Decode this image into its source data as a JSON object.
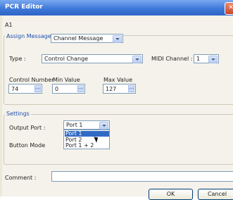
{
  "window": {
    "title": "PCR Editor",
    "close_glyph": "✕"
  },
  "section": {
    "name": "A1"
  },
  "assign": {
    "legend": "Assign Message :",
    "message_value": "Channel Message",
    "type_label": "Type :",
    "type_value": "Control Change",
    "midi_label": "MIDI Channel :",
    "midi_value": "1",
    "control_number_label": "Control Number",
    "control_number_value": "74",
    "min_label": "Min Value",
    "min_value": "0",
    "max_label": "Max Value",
    "max_value": "127"
  },
  "settings": {
    "legend": "Settings",
    "output_port_label": "Output Port :",
    "output_port_value": "Port 1",
    "output_port_options": [
      "Port 1",
      "Port 2",
      "Port 1 + 2"
    ],
    "button_mode_label": "Button Mode"
  },
  "comment": {
    "label": "Comment :",
    "value": ""
  },
  "buttons": {
    "ok": "OK",
    "cancel": "Cancel"
  },
  "colors": {
    "accent": "#316ac5",
    "titlebar": "#3f79d9",
    "legend_text": "#1f4fb0"
  },
  "icons": {
    "spin_up": "triangle-up-icon",
    "spin_down": "triangle-down-icon",
    "dropdown": "chevron-down-icon",
    "pointer": "mouse-pointer-icon"
  }
}
